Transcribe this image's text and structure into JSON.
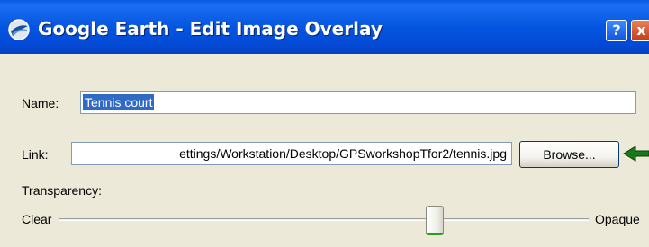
{
  "window": {
    "title": "Google Earth - Edit Image Overlay",
    "help_label": "?",
    "close_label": "x",
    "app_icon": "google-earth-icon"
  },
  "form": {
    "name_label": "Name:",
    "name_value": "Tennis court",
    "link_label": "Link:",
    "link_value": "ettings/Workstation/Desktop/GPSworkshopTfor2/tennis.jpg",
    "browse_label": "Browse...",
    "transparency_label": "Transparency:",
    "clear_label": "Clear",
    "opaque_label": "Opaque",
    "transparency_level": 0.71
  },
  "colors": {
    "titlebar": "#0555e0",
    "selection": "#316ac5",
    "annotation_arrow": "#1a7a1a"
  }
}
